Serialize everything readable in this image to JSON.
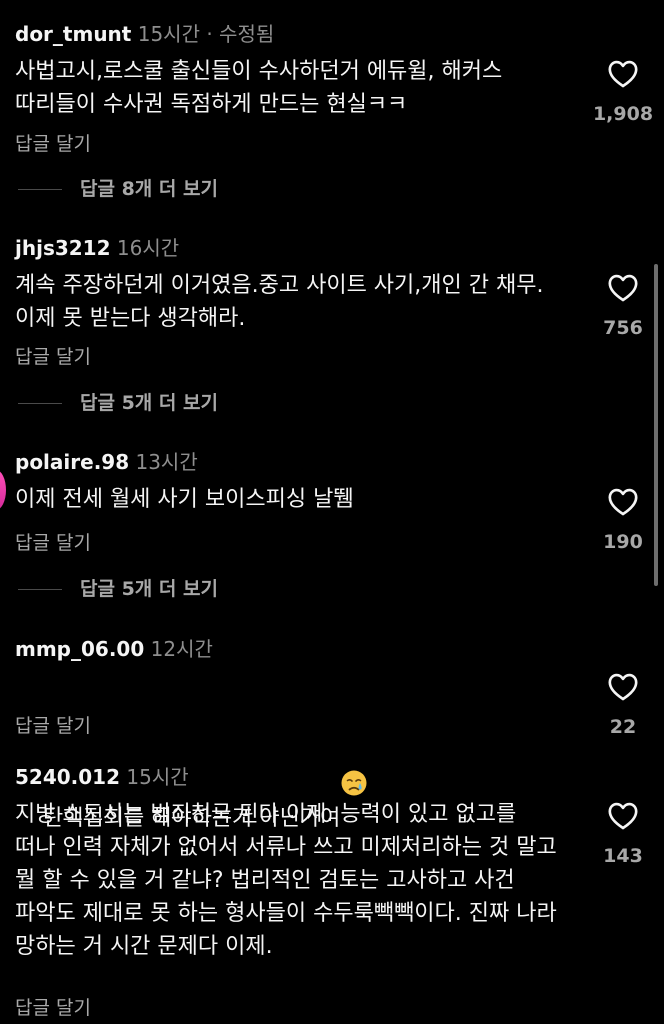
{
  "comments": [
    {
      "username": "dor_tmunt",
      "time": "15시간",
      "edited": "수정됨",
      "text": "사법고시,로스쿨 출신들이 수사하던거 에듀윌, 해커스 따리들이 수사권 독점하게 만드는 현실ㅋㅋ",
      "reply_label": "답글 달기",
      "likes": "1,908",
      "view_replies": "답글 8개 더 보기"
    },
    {
      "username": "jhjs3212",
      "time": "16시간",
      "text": "계속 주장하던게 이거였음.중고 사이트 사기,개인 간 채무.이제 못 받는다 생각해라.",
      "reply_label": "답글 달기",
      "likes": "756",
      "view_replies": "답글 5개 더 보기"
    },
    {
      "username": "polaire.98",
      "time": "13시간",
      "text": "이제 전세 월세 사기 보이스피싱 날뛤",
      "reply_label": "답글 달기",
      "likes": "190",
      "view_replies": "답글 5개 더 보기"
    },
    {
      "username": "mmp_06.00",
      "time": "12시간",
      "text": "탄핵집회를 해야하는거 아닌가여",
      "emoji": "crying-face",
      "reply_label": "답글 달기",
      "likes": "22"
    },
    {
      "username": "5240.012",
      "time": "15시간",
      "text": "지방 소도시는 범죄천국 된다 이제. 능력이 있고 없고를 떠나 인력 자체가 없어서 서류나 쓰고 미제처리하는 것 말고 뭘 할 수 있을 거 같냐? 법리적인 검토는 고사하고 사건 파악도 제대로 못 하는 형사들이 수두룩빽빽이다. 진짜 나라 망하는 거 시간 문제다 이제.",
      "reply_label": "답글 달기",
      "likes": "143"
    }
  ],
  "meta_separator": "·",
  "icons": {
    "like": "heart-outline-icon",
    "emoji": "crying-face-emoji"
  },
  "colors": {
    "background": "#000000",
    "text": "#f5f5f5",
    "muted": "#a8a8a8"
  }
}
